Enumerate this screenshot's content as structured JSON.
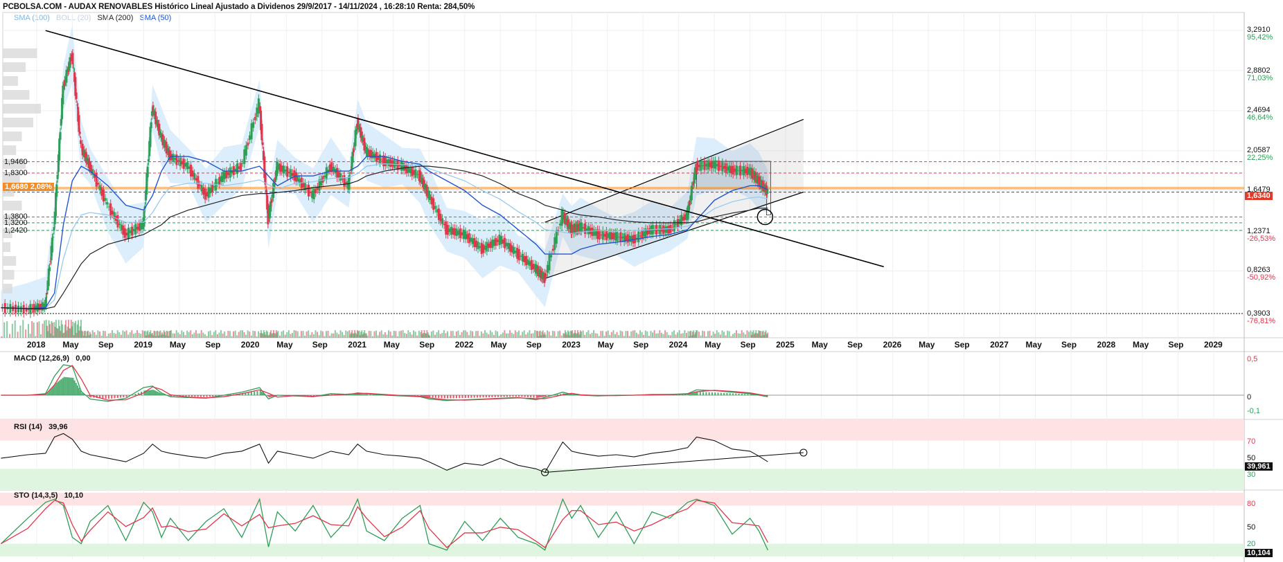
{
  "header": {
    "title": "PCBOLSA.COM - AUDAX RENOVABLES Histórico Lineal Ajustado a Dividenos 29/9/2017 - 14/11/2024 , 16:28:10 Renta: 284,50%",
    "legend": [
      {
        "label": "SMA (100)",
        "color": "#90c8f0"
      },
      {
        "label": "BOLL (20)",
        "color": "#c8d8e8"
      },
      {
        "label": "SMA (200)",
        "color": "#222222"
      },
      {
        "label": "SMA (50)",
        "color": "#2255cc"
      }
    ]
  },
  "colors": {
    "up": "#2e9e57",
    "down": "#e0364b",
    "sma50": "#2255cc",
    "sma100": "#90c8f0",
    "sma200": "#222222",
    "boll_fill": "#d6ebfb",
    "trendline": "#000000",
    "current_badge": "#e23a2a",
    "left_badge": "#f28c28"
  },
  "price_axis": {
    "ticks": [
      "3,2910",
      "2,8802",
      "2,4694",
      "2,0587",
      "1,6479",
      "1,2371",
      "0,8263",
      "0,3903"
    ],
    "pcts": [
      "95,42%",
      "71,03%",
      "46,64%",
      "22,25%",
      "-26,53%",
      "-50,92%",
      "-76,81%"
    ],
    "current_price": "1,6340"
  },
  "left_levels": {
    "labels": [
      "1,9460",
      "1,8300",
      "1,3800",
      "1,3200",
      "1,2420"
    ],
    "highlight": "1,6680",
    "highlight_pct": "2,08%"
  },
  "dates": [
    "2018",
    "May",
    "Sep",
    "2019",
    "May",
    "Sep",
    "2020",
    "May",
    "Sep",
    "2021",
    "May",
    "Sep",
    "2022",
    "May",
    "Sep",
    "2023",
    "May",
    "Sep",
    "2024",
    "May",
    "Sep",
    "2025",
    "May",
    "Sep",
    "2026",
    "May",
    "Sep",
    "2027",
    "May",
    "Sep",
    "2028",
    "May",
    "Sep",
    "2029"
  ],
  "macd": {
    "label": "MACD (12,26,9)",
    "value": "0,00",
    "ticks": [
      "0,5",
      "0",
      "-0,1"
    ]
  },
  "rsi": {
    "label": "RSI (14)",
    "value": "39,96",
    "ticks": [
      "70",
      "50",
      "30"
    ],
    "current": "39,961"
  },
  "sto": {
    "label": "STO (14,3,5)",
    "value": "10,10",
    "ticks": [
      "80",
      "50",
      "20"
    ],
    "current": "10,104"
  },
  "chart_data": {
    "type": "line",
    "title": "PCBOLSA.COM - AUDAX RENOVABLES Histórico Lineal Ajustado a Dividenos 29/9/2017 - 14/11/2024 , 16:28:10 Renta: 284,50%",
    "xlabel": "",
    "ylabel": "",
    "ylim": [
      0.3903,
      3.291
    ],
    "x": [
      "2017-09",
      "2017-12",
      "2018-02",
      "2018-03",
      "2018-04",
      "2018-05",
      "2018-06",
      "2018-07",
      "2018-09",
      "2018-11",
      "2019-01",
      "2019-02",
      "2019-03",
      "2019-04",
      "2019-06",
      "2019-08",
      "2019-10",
      "2019-12",
      "2020-02",
      "2020-03",
      "2020-04",
      "2020-06",
      "2020-08",
      "2020-10",
      "2020-12",
      "2021-01",
      "2021-02",
      "2021-04",
      "2021-06",
      "2021-08",
      "2021-09",
      "2021-11",
      "2022-01",
      "2022-03",
      "2022-05",
      "2022-07",
      "2022-09",
      "2022-10",
      "2022-12",
      "2023-01",
      "2023-02",
      "2023-04",
      "2023-06",
      "2023-08",
      "2023-10",
      "2023-12",
      "2024-02",
      "2024-03",
      "2024-05",
      "2024-07",
      "2024-09",
      "2024-10",
      "2024-11"
    ],
    "series": [
      {
        "name": "AUDAX RENOVABLES",
        "values": [
          0.45,
          0.43,
          0.47,
          1.3,
          2.7,
          3.05,
          2.1,
          1.9,
          1.5,
          1.2,
          1.3,
          2.5,
          2.2,
          2.0,
          1.9,
          1.6,
          1.8,
          1.9,
          2.55,
          1.35,
          1.9,
          1.8,
          1.6,
          1.9,
          1.7,
          2.35,
          2.05,
          1.95,
          1.9,
          1.8,
          1.6,
          1.25,
          1.2,
          1.05,
          1.15,
          1.0,
          0.85,
          0.75,
          1.4,
          1.25,
          1.28,
          1.2,
          1.18,
          1.15,
          1.25,
          1.25,
          1.4,
          1.9,
          1.92,
          1.86,
          1.85,
          1.75,
          1.634
        ]
      },
      {
        "name": "SMA (50)",
        "values": [
          0.45,
          0.44,
          0.45,
          0.6,
          1.3,
          1.75,
          1.9,
          1.85,
          1.7,
          1.5,
          1.45,
          1.6,
          1.85,
          2.0,
          2.0,
          1.95,
          1.85,
          1.85,
          1.9,
          1.8,
          1.7,
          1.8,
          1.8,
          1.85,
          1.85,
          1.9,
          2.0,
          2.0,
          1.95,
          1.92,
          1.85,
          1.75,
          1.65,
          1.5,
          1.4,
          1.25,
          1.1,
          1.0,
          1.0,
          1.0,
          1.05,
          1.1,
          1.12,
          1.15,
          1.18,
          1.2,
          1.25,
          1.35,
          1.55,
          1.65,
          1.7,
          1.7,
          1.66
        ]
      },
      {
        "name": "SMA (200)",
        "values": [
          0.45,
          0.44,
          0.44,
          0.46,
          0.6,
          0.75,
          0.9,
          1.0,
          1.1,
          1.15,
          1.2,
          1.25,
          1.3,
          1.38,
          1.45,
          1.5,
          1.55,
          1.6,
          1.62,
          1.62,
          1.63,
          1.65,
          1.68,
          1.7,
          1.72,
          1.75,
          1.8,
          1.85,
          1.88,
          1.9,
          1.9,
          1.88,
          1.85,
          1.8,
          1.72,
          1.62,
          1.55,
          1.5,
          1.45,
          1.42,
          1.4,
          1.38,
          1.35,
          1.33,
          1.32,
          1.32,
          1.32,
          1.33,
          1.38,
          1.42,
          1.45,
          1.47,
          1.47
        ]
      }
    ],
    "horizontal_levels": [
      1.946,
      1.83,
      1.668,
      1.634,
      1.38,
      1.32,
      1.242,
      0.3903
    ],
    "indicators": {
      "macd": {
        "ylim": [
          -0.1,
          0.5
        ],
        "values": [
          0.0,
          0.0,
          0.02,
          0.25,
          0.4,
          0.38,
          0.05,
          -0.05,
          -0.08,
          -0.04,
          0.1,
          0.12,
          0.03,
          -0.02,
          -0.03,
          -0.04,
          0.0,
          0.04,
          0.1,
          -0.05,
          0.0,
          -0.01,
          -0.02,
          0.02,
          0.01,
          0.03,
          0.02,
          0.0,
          -0.01,
          -0.02,
          -0.05,
          -0.07,
          -0.06,
          -0.05,
          -0.04,
          -0.03,
          -0.06,
          -0.03,
          0.04,
          0.01,
          0.0,
          -0.01,
          0.0,
          0.0,
          0.01,
          0.01,
          0.02,
          0.07,
          0.06,
          0.04,
          0.02,
          0.0,
          -0.02
        ]
      },
      "rsi": {
        "ylim": [
          0,
          100
        ],
        "values": [
          45,
          50,
          52,
          75,
          80,
          72,
          55,
          50,
          45,
          40,
          52,
          65,
          55,
          52,
          48,
          45,
          52,
          55,
          65,
          38,
          55,
          50,
          45,
          55,
          50,
          65,
          55,
          50,
          48,
          45,
          40,
          28,
          38,
          35,
          45,
          35,
          30,
          25,
          68,
          55,
          52,
          48,
          50,
          47,
          52,
          55,
          60,
          75,
          70,
          58,
          55,
          48,
          40
        ]
      },
      "sto": {
        "ylim": [
          0,
          100
        ],
        "values": [
          20,
          60,
          85,
          90,
          80,
          30,
          20,
          55,
          80,
          25,
          85,
          70,
          30,
          60,
          25,
          55,
          75,
          30,
          90,
          15,
          70,
          40,
          80,
          30,
          60,
          90,
          40,
          25,
          60,
          80,
          20,
          10,
          55,
          25,
          60,
          30,
          20,
          10,
          90,
          60,
          80,
          30,
          70,
          20,
          70,
          60,
          85,
          90,
          80,
          35,
          60,
          40,
          10
        ]
      }
    }
  }
}
